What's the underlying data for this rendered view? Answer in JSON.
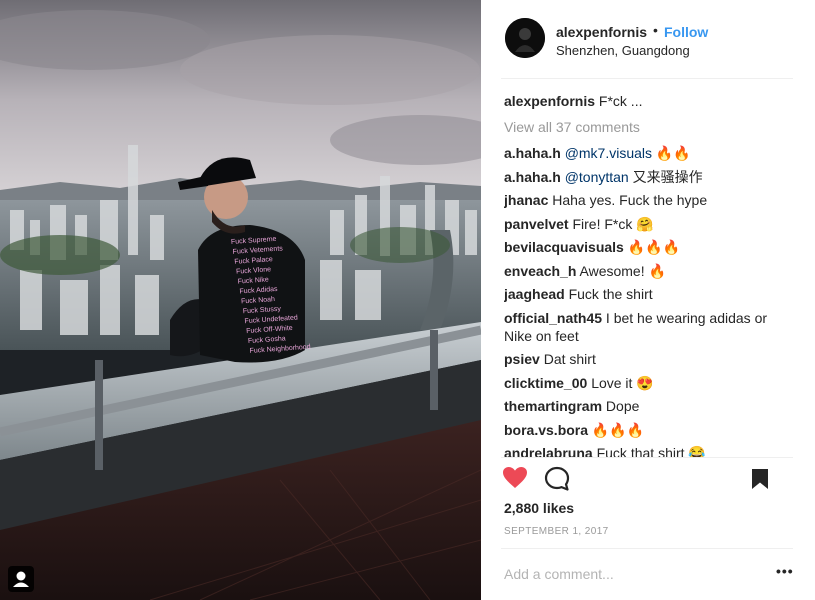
{
  "post": {
    "author": "alexpenfornis",
    "follow_label": "Follow",
    "separator": "•",
    "location": "Shenzhen, Guangdong"
  },
  "caption": {
    "username": "alexpenfornis",
    "text": "F*ck ..."
  },
  "view_all_comments": "View all 37 comments",
  "comments": [
    {
      "username": "a.haha.h",
      "text": "@mk7.visuals 🔥🔥"
    },
    {
      "username": "a.haha.h",
      "text": "@tonyttan 又来骚操作"
    },
    {
      "username": "jhanac",
      "text": "Haha yes. Fuck the hype"
    },
    {
      "username": "panvelvet",
      "text": "Fire! F*ck 🤗"
    },
    {
      "username": "bevilacquavisuals",
      "text": "🔥🔥🔥"
    },
    {
      "username": "enveach_h",
      "text": "Awesome! 🔥"
    },
    {
      "username": "jaaghead",
      "text": "Fuck the shirt"
    },
    {
      "username": "official_nath45",
      "text": "I bet he wearing adidas or Nike on feet"
    },
    {
      "username": "psiev",
      "text": "Dat shirt"
    },
    {
      "username": "clicktime_00",
      "text": "Love it 😍"
    },
    {
      "username": "themartingram",
      "text": "Dope"
    },
    {
      "username": "bora.vs.bora",
      "text": "🔥🔥🔥"
    },
    {
      "username": "andrelabruna",
      "text": "Fuck that shirt 😂"
    }
  ],
  "likes": "2,880 likes",
  "date": "SEPTEMBER 1, 2017",
  "add_comment_placeholder": "Add a comment...",
  "more_options": "•••",
  "colors": {
    "follow": "#3897f0",
    "like_heart": "#ed4956",
    "muted": "#999999"
  },
  "icons": {
    "like": "heart-icon",
    "comment": "speech-bubble-icon",
    "save": "bookmark-icon",
    "user_tag": "person-icon"
  }
}
